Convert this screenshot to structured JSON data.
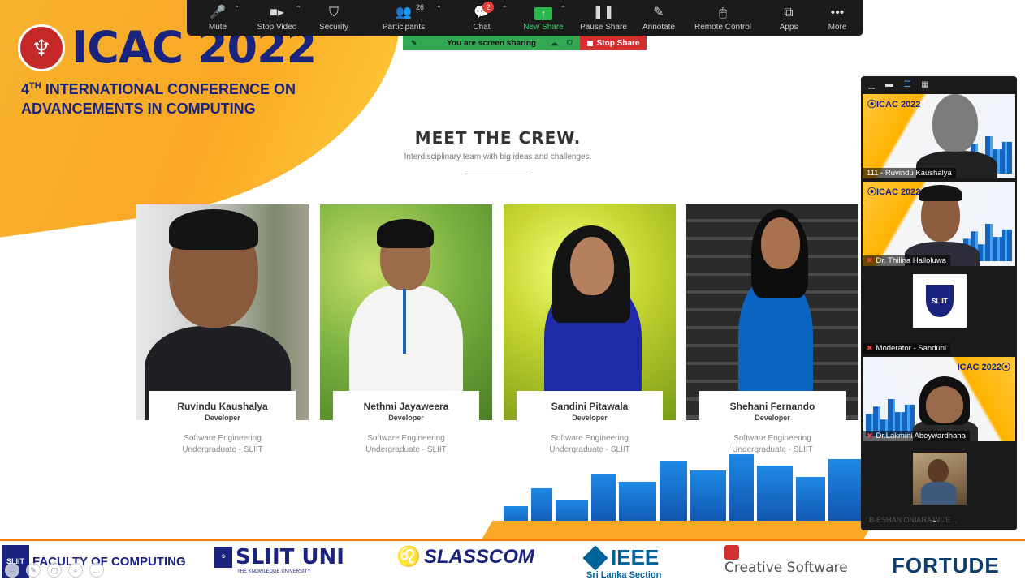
{
  "zoom_toolbar": {
    "items": [
      {
        "label": "Mute",
        "icon": "microphone-icon"
      },
      {
        "label": "Stop Video",
        "icon": "video-camera-icon"
      },
      {
        "label": "Security",
        "icon": "shield-icon"
      },
      {
        "label": "Participants",
        "icon": "participants-icon",
        "count": "26"
      },
      {
        "label": "Chat",
        "icon": "chat-bubble-icon",
        "badge": "2"
      },
      {
        "label": "New Share",
        "icon": "share-arrow-icon"
      },
      {
        "label": "Pause Share",
        "icon": "pause-icon"
      },
      {
        "label": "Annotate",
        "icon": "pencil-icon"
      },
      {
        "label": "Remote Control",
        "icon": "mouse-icon"
      },
      {
        "label": "Apps",
        "icon": "apps-icon"
      },
      {
        "label": "More",
        "icon": "ellipsis-icon"
      }
    ]
  },
  "share_banner": {
    "text": "You are screen sharing",
    "stop_label": "Stop Share"
  },
  "slide": {
    "logo_text": "ICAC 2022",
    "conference_line1_prefix": "4",
    "conference_line1_sup": "TH",
    "conference_line1_rest": " INTERNATIONAL CONFERENCE ON",
    "conference_line2": "ADVANCEMENTS IN COMPUTING",
    "section_title": "MEET THE CREW.",
    "section_subtitle": "Interdisciplinary team with big ideas and challenges.",
    "crew": [
      {
        "name": "Ruvindu Kaushalya",
        "role": "Developer",
        "desc1": "Software Engineering",
        "desc2": "Undergraduate - SLIIT"
      },
      {
        "name": "Nethmi Jayaweera",
        "role": "Developer",
        "desc1": "Software Engineering",
        "desc2": "Undergraduate - SLIIT"
      },
      {
        "name": "Sandini Pitawala",
        "role": "Developer",
        "desc1": "Software Engineering",
        "desc2": "Undergraduate - SLIIT"
      },
      {
        "name": "Shehani Fernando",
        "role": "Developer",
        "desc1": "Software Engineering",
        "desc2": "Undergraduate - SLIIT"
      }
    ],
    "sponsors": {
      "faculty": "FACULTY OF COMPUTING",
      "sliit_uni": "SLIIT UNI",
      "sliit_tag": "THE KNOWLEDGE UNIVERSITY",
      "slasscom": "SLASSCOM",
      "ieee": "IEEE",
      "ieee_sub": "Sri Lanka Section",
      "creative": "Creative Software",
      "fortude": "FORTUDE"
    }
  },
  "gallery": {
    "controls": [
      "minimize-icon",
      "speaker-view-icon",
      "strip-view-icon",
      "gallery-grid-icon"
    ],
    "tiles": [
      {
        "name": "111 - Ruvindu Kaushalya",
        "muted": false
      },
      {
        "name": "Dr. Thilina Halloluwa",
        "muted": true
      },
      {
        "name": "Moderator - Sanduni",
        "muted": true
      },
      {
        "name": "Dr.Lakmini Abeywardhana",
        "muted": true
      }
    ],
    "last_tile_name": "B-ESHAN ONIARA WIJE..."
  },
  "colors": {
    "brand_navy": "#1a237e",
    "brand_orange": "#f9a825",
    "share_green": "#33a853",
    "stop_red": "#d32f2f"
  }
}
